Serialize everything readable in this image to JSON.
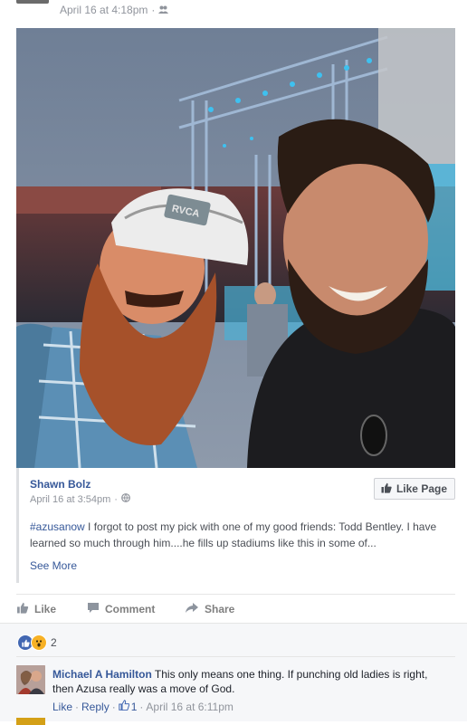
{
  "post": {
    "time": "April 16 at 4:18pm",
    "separator": "·",
    "audience_icon": "friends-icon"
  },
  "shared": {
    "author": "Shawn Bolz",
    "time": "April 16 at 3:54pm",
    "separator": "·",
    "audience_icon": "globe-icon",
    "like_page_label": "Like Page",
    "hashtag": "#azusanow",
    "text": " I forgot to post my pick with one of my good friends: Todd Bentley. I have learned so much through him....he fills up stadiums like this in some of...",
    "see_more": "See More",
    "cap_text": "RVCA"
  },
  "actions": {
    "like": "Like",
    "comment": "Comment",
    "share": "Share"
  },
  "reactions": {
    "count": "2"
  },
  "comment": {
    "name": "Michael A Hamilton",
    "text": " This only means one thing. If punching old ladies is right, then Azusa really was a move of God.",
    "like": "Like",
    "reply": "Reply",
    "like_count": "1",
    "dot": "·",
    "time": "April 16 at 6:11pm"
  },
  "colors": {
    "link": "#365899",
    "meta": "#90949c",
    "stage_light": "#3ec1f0"
  }
}
